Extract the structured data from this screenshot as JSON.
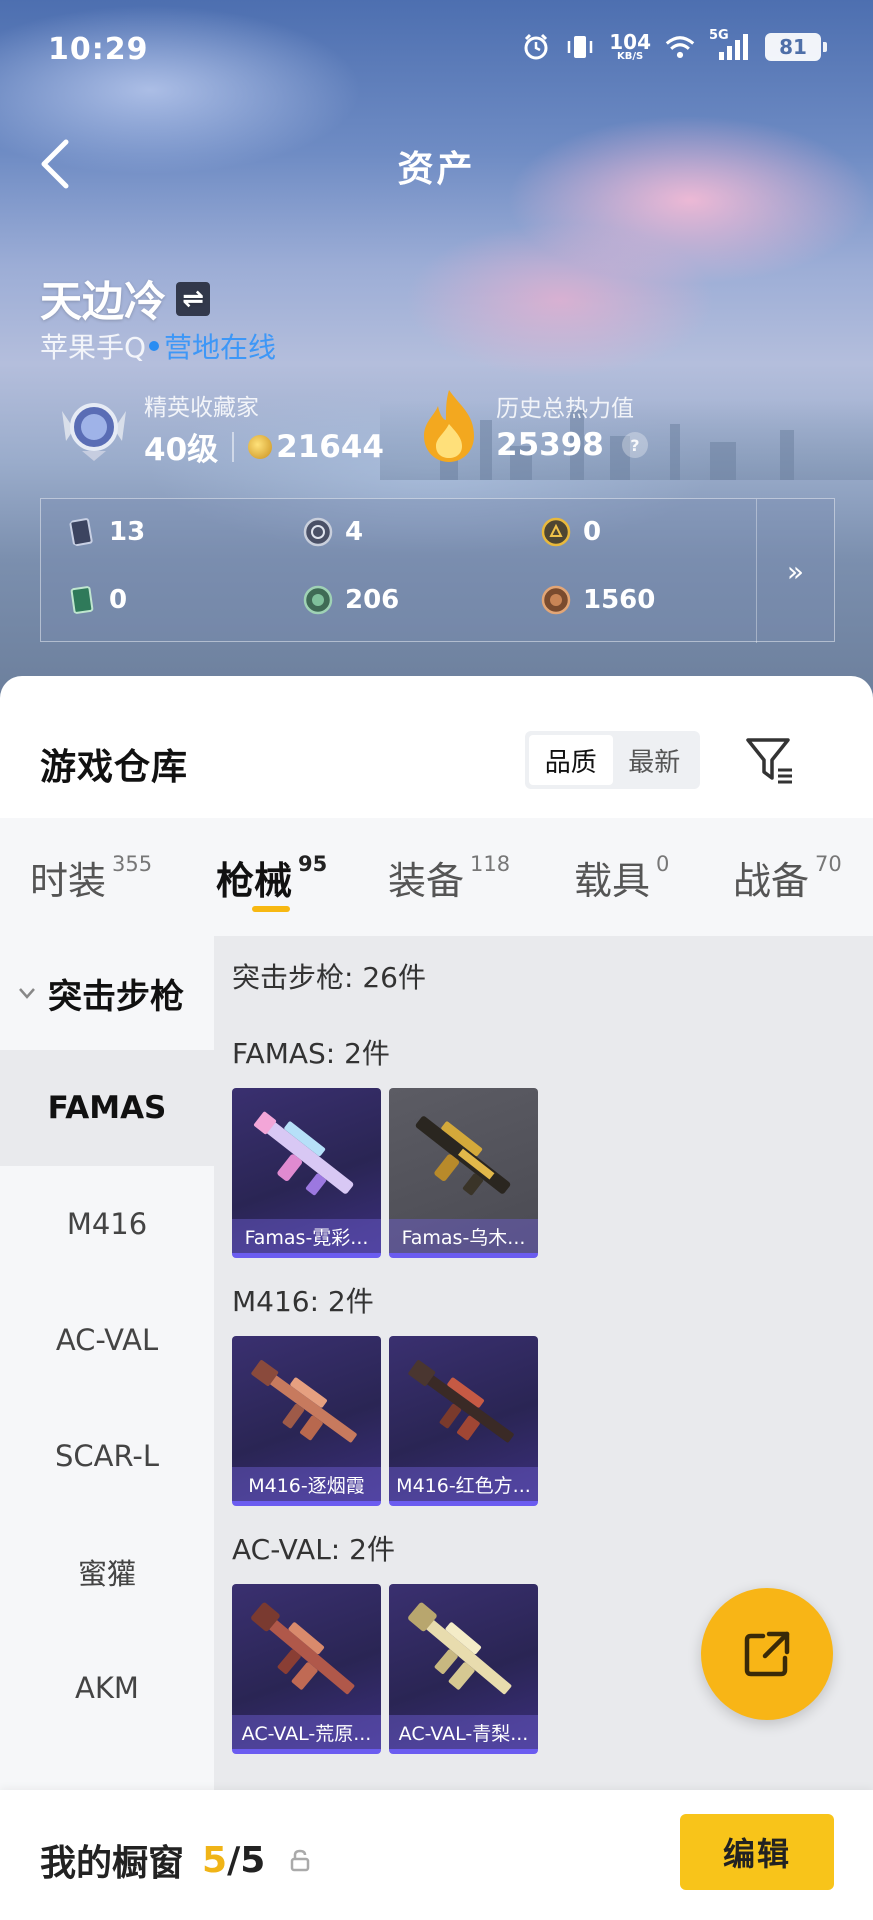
{
  "status_bar": {
    "time": "10:29",
    "net_speed_value": "104",
    "net_speed_unit": "KB/S",
    "signal_label": "5G",
    "battery": "81"
  },
  "header": {
    "title": "资产"
  },
  "player": {
    "name": "天边冷",
    "platform": "苹果手Q",
    "status": "营地在线",
    "rank_title": "精英收藏家",
    "level": "40级",
    "coins": "21644",
    "heat_label": "历史总热力值",
    "heat_value": "25398"
  },
  "currencies": [
    {
      "icon": "card-icon",
      "value": "13"
    },
    {
      "icon": "silver-coin-icon",
      "value": "4"
    },
    {
      "icon": "gold-badge-icon",
      "value": "0"
    },
    {
      "icon": "green-card-icon",
      "value": "0"
    },
    {
      "icon": "green-coin-icon",
      "value": "206"
    },
    {
      "icon": "bronze-coin-icon",
      "value": "1560"
    }
  ],
  "warehouse": {
    "title": "游戏仓库",
    "sort_options": [
      "品质",
      "最新"
    ],
    "active_sort": "品质"
  },
  "tabs": [
    {
      "label": "时装",
      "count": "355"
    },
    {
      "label": "枪械",
      "count": "95"
    },
    {
      "label": "装备",
      "count": "118"
    },
    {
      "label": "载具",
      "count": "0"
    },
    {
      "label": "战备",
      "count": "70"
    }
  ],
  "active_tab": "枪械",
  "side_nav": {
    "category": "突击步枪",
    "items": [
      "FAMAS",
      "M416",
      "AC-VAL",
      "SCAR-L",
      "蜜獾",
      "AKM"
    ],
    "active": "FAMAS"
  },
  "main": {
    "category_total": "突击步枪: 26件",
    "sections": [
      {
        "title": "FAMAS: 2件",
        "items": [
          "Famas-霓彩...",
          "Famas-乌木..."
        ]
      },
      {
        "title": "M416: 2件",
        "items": [
          "M416-逐烟霞",
          "M416-红色方..."
        ]
      },
      {
        "title": "AC-VAL: 2件",
        "items": [
          "AC-VAL-荒原...",
          "AC-VAL-青梨..."
        ]
      }
    ]
  },
  "bottom": {
    "showcase_label": "我的橱窗",
    "showcase_current": "5",
    "showcase_sep": "/",
    "showcase_max": "5",
    "edit_label": "编辑"
  },
  "colors": {
    "accent": "#f8b516",
    "tab_indicator": "#f7b812",
    "online": "#3d97f7",
    "card_bar": "#6b5cf0"
  }
}
